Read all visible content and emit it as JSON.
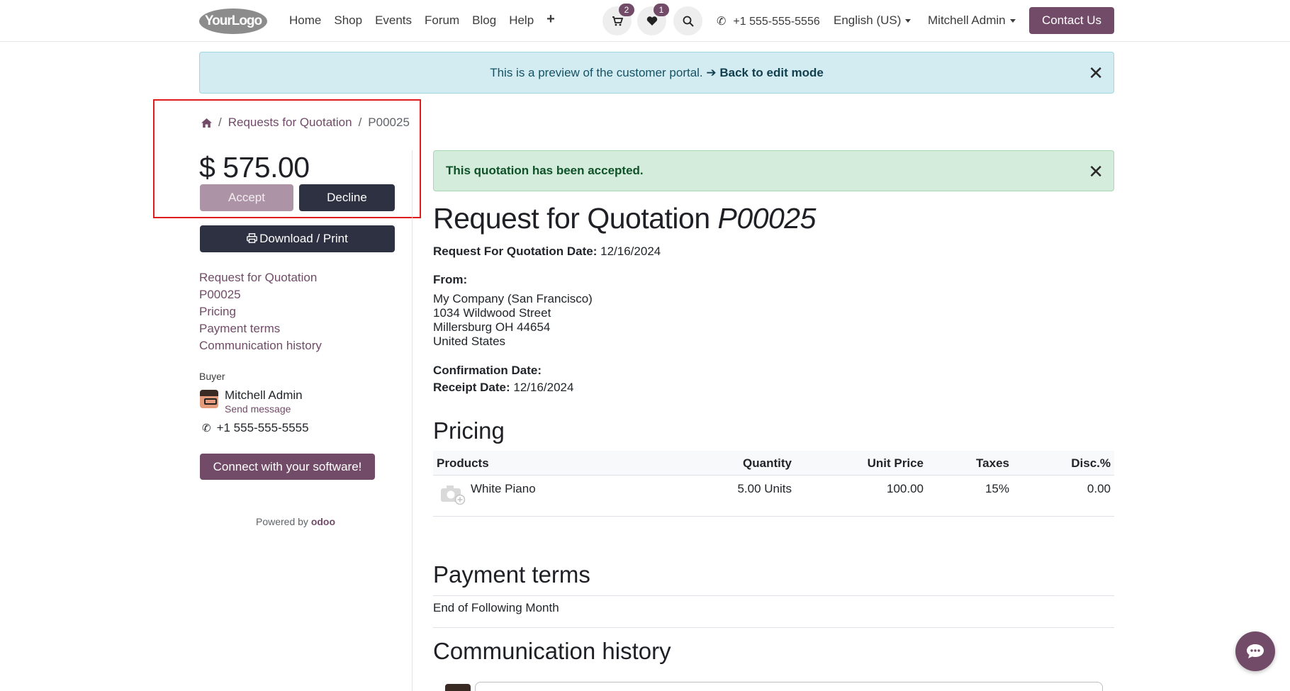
{
  "header": {
    "logo": "YourLogo",
    "nav": [
      "Home",
      "Shop",
      "Events",
      "Forum",
      "Blog",
      "Help"
    ],
    "cart_count": "2",
    "wishlist_count": "1",
    "phone": "+1 555-555-5556",
    "language": "English (US)",
    "user": "Mitchell Admin",
    "contact_button": "Contact Us"
  },
  "preview_banner": {
    "text": "This is a preview of the customer portal.",
    "link": "➔ Back to edit mode"
  },
  "breadcrumb": {
    "items": [
      "Requests for Quotation",
      "P00025"
    ]
  },
  "sidebar": {
    "amount": "$ 575.00",
    "accept_label": "Accept",
    "decline_label": "Decline",
    "download_label": "Download / Print",
    "toc": [
      "Request for Quotation",
      "P00025",
      "Pricing",
      "Payment terms",
      "Communication history"
    ],
    "buyer_label": "Buyer",
    "buyer_name": "Mitchell Admin",
    "send_message": "Send message",
    "buyer_phone": "+1 555-555-5555",
    "connect_label": "Connect with your software!",
    "powered_by": "Powered by",
    "powered_brand": "odoo"
  },
  "main": {
    "alert": "This quotation has been accepted.",
    "title_prefix": "Request for Quotation",
    "title_ref": "P00025",
    "rfq_date_label": "Request For Quotation Date:",
    "rfq_date": "12/16/2024",
    "from_label": "From:",
    "address": [
      "My Company (San Francisco)",
      "1034 Wildwood Street",
      "Millersburg OH 44654",
      "United States"
    ],
    "confirmation_label": "Confirmation Date:",
    "receipt_label": "Receipt Date:",
    "receipt_date": "12/16/2024",
    "pricing_title": "Pricing",
    "table": {
      "headers": [
        "Products",
        "Quantity",
        "Unit Price",
        "Taxes",
        "Disc.%"
      ],
      "rows": [
        [
          "White Piano",
          "5.00 Units",
          "100.00",
          "15%",
          "0.00"
        ]
      ]
    },
    "payment_terms_title": "Payment terms",
    "payment_terms": "End of Following Month",
    "communication_title": "Communication history"
  },
  "colors": {
    "brand": "#714b67",
    "dark": "#2d3142",
    "accept_disabled": "#ad93a6",
    "info_bg": "#d2ecf2",
    "success_bg": "#d4ecdb",
    "highlight_border": "#e01b1b"
  },
  "icons": [
    "home-icon",
    "cart-icon",
    "heart-icon",
    "search-icon",
    "phone-icon",
    "print-icon",
    "close-icon",
    "camera-icon",
    "chat-icon",
    "plus-icon"
  ]
}
